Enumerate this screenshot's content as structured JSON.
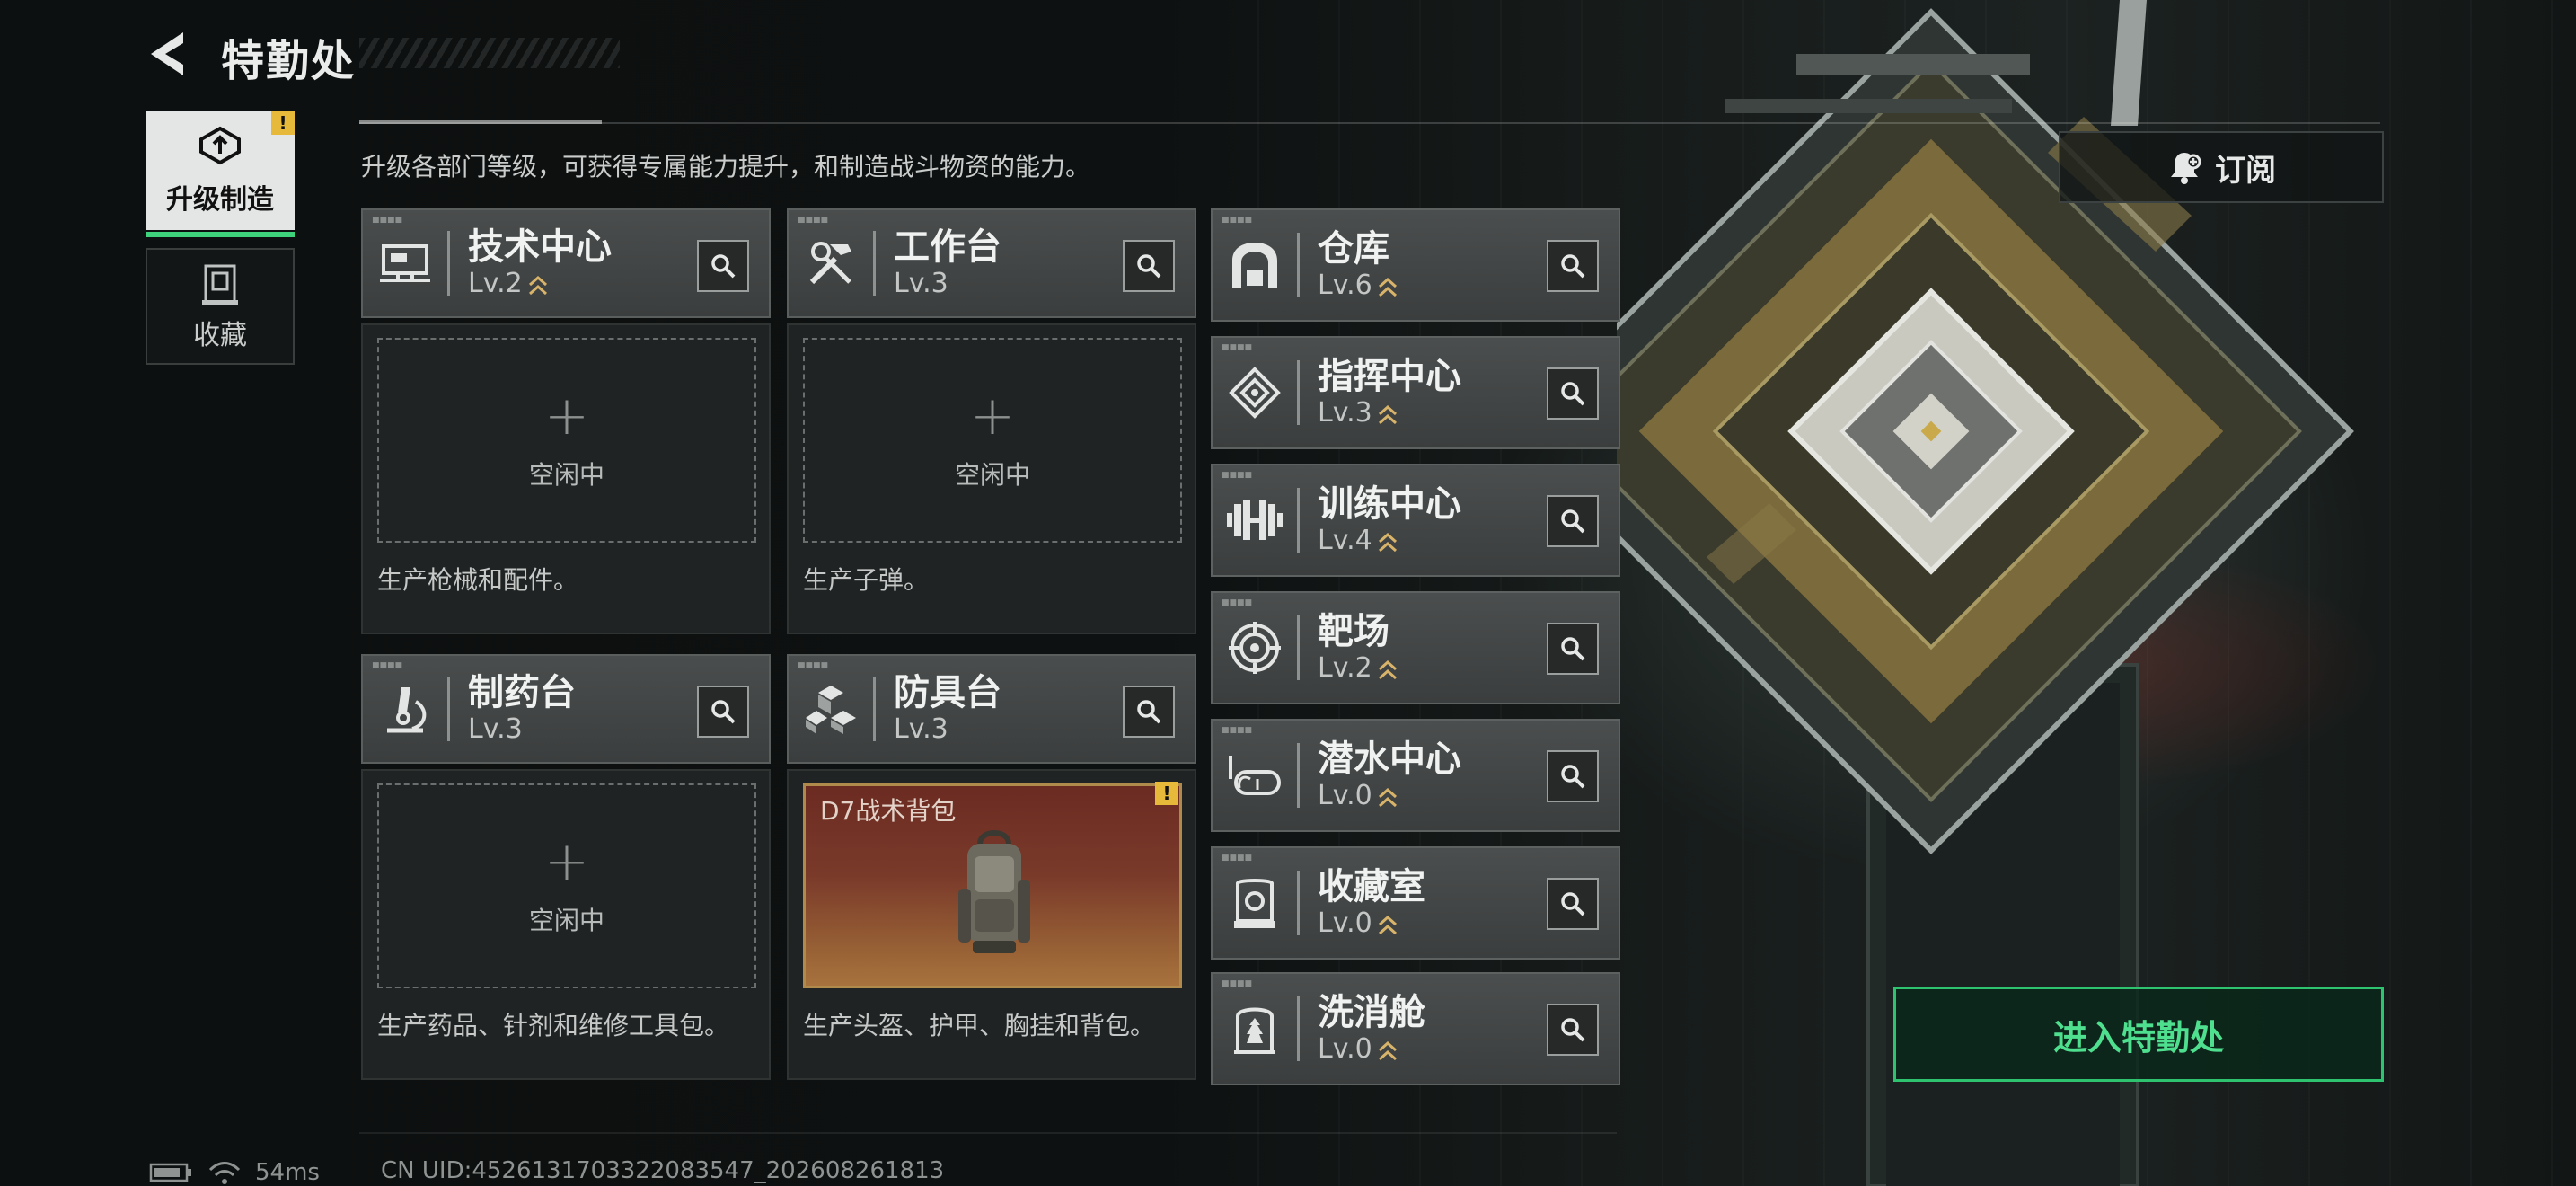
{
  "header": {
    "title": "特勤处"
  },
  "nav": [
    {
      "label": "升级制造",
      "active": true,
      "alert": "!"
    },
    {
      "label": "收藏",
      "active": false
    }
  ],
  "intro": "升级各部门等级，可获得专属能力提升，和制造战斗物资的能力。",
  "subscribe_label": "订阅",
  "stations": [
    {
      "name": "技术中心",
      "level": "Lv.2",
      "upgradable": true,
      "status": "空闲中",
      "desc": "生产枪械和配件。"
    },
    {
      "name": "工作台",
      "level": "Lv.3",
      "upgradable": false,
      "status": "空闲中",
      "desc": "生产子弹。"
    },
    {
      "name": "制药台",
      "level": "Lv.3",
      "upgradable": false,
      "status": "空闲中",
      "desc": "生产药品、针剂和维修工具包。"
    },
    {
      "name": "防具台",
      "level": "Lv.3",
      "upgradable": false,
      "product": "D7战术背包",
      "alert": "!",
      "desc": "生产头盔、护甲、胸挂和背包。"
    }
  ],
  "facilities": [
    {
      "name": "仓库",
      "level": "Lv.6",
      "icon": "warehouse-icon"
    },
    {
      "name": "指挥中心",
      "level": "Lv.3",
      "icon": "command-icon"
    },
    {
      "name": "训练中心",
      "level": "Lv.4",
      "icon": "dumbbell-icon"
    },
    {
      "name": "靶场",
      "level": "Lv.2",
      "icon": "target-icon"
    },
    {
      "name": "潜水中心",
      "level": "Lv.0",
      "icon": "goggles-icon"
    },
    {
      "name": "收藏室",
      "level": "Lv.0",
      "icon": "showcase-icon"
    },
    {
      "name": "洗消舱",
      "level": "Lv.0",
      "icon": "decon-icon"
    }
  ],
  "enter_label": "进入特勤处",
  "status": {
    "ping": "54ms",
    "uid": "CN UID:4526131703322083547_202608261813"
  },
  "colors": {
    "accent": "#2ec46f",
    "alert": "#e6b93a",
    "upgrade": "#d8b46a"
  }
}
